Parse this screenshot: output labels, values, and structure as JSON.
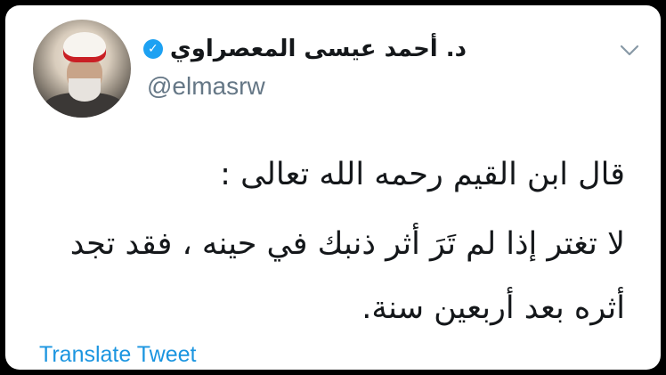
{
  "user": {
    "display_name": "د. أحمد عيسى المعصراوي",
    "handle": "@elmasrw",
    "verified": true
  },
  "tweet": {
    "lines": [
      "قال ابن القيم رحمه الله تعالى :",
      "لا تغتر إذا لم تَرَ أثر ذنبك في حينه ، فقد تجد",
      "أثره بعد أربعين سنة."
    ]
  },
  "actions": {
    "translate_label": "Translate Tweet"
  },
  "colors": {
    "verified_badge": "#1da1f2",
    "link": "#1b95e0",
    "text": "#14171a",
    "secondary_text": "#657786"
  }
}
